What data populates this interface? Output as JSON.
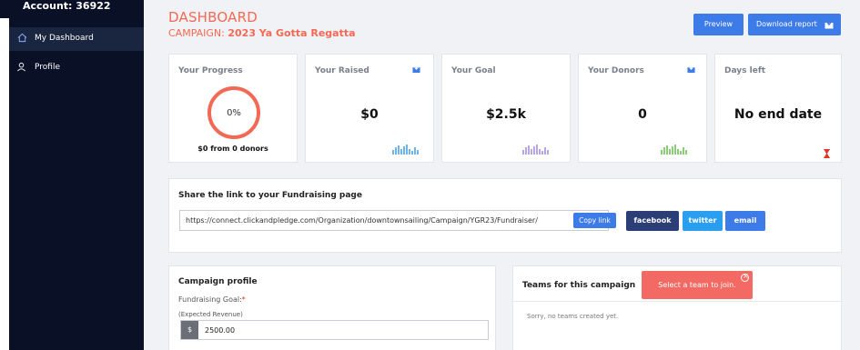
{
  "sidebar": {
    "account_label": "Account: 36922",
    "items": [
      {
        "label": "My Dashboard",
        "icon": "home-icon",
        "active": true
      },
      {
        "label": "Profile",
        "icon": "user-icon",
        "active": false
      }
    ]
  },
  "header": {
    "title": "DASHBOARD",
    "campaign_prefix": "CAMPAIGN:",
    "campaign_name": "2023 Ya Gotta Regatta",
    "preview_label": "Preview",
    "download_label": "Download report"
  },
  "stats": {
    "progress": {
      "title": "Your Progress",
      "percent": "0%",
      "sub": "$0 from 0 donors"
    },
    "raised": {
      "title": "Your Raised",
      "value": "$0"
    },
    "goal": {
      "title": "Your Goal",
      "value": "$2.5k"
    },
    "donors": {
      "title": "Your Donors",
      "value": "0"
    },
    "days": {
      "title": "Days left",
      "value": "No end date"
    }
  },
  "share": {
    "title": "Share the link to your Fundraising page",
    "url": "https://connect.clickandpledge.com/Organization/downtownsailing/Campaign/YGR23/Fundraiser/",
    "copy_label": "Copy link",
    "facebook_label": "facebook",
    "twitter_label": "twitter",
    "email_label": "email"
  },
  "profile": {
    "title": "Campaign profile",
    "goal_label": "Fundraising Goal:",
    "required_mark": "*",
    "expected_label": "(Expected Revenue)",
    "currency": "$",
    "amount": "2500.00"
  },
  "teams": {
    "title": "Teams for this campaign",
    "empty_text": "Sorry, no teams created yet.",
    "toast": "Select a team to join."
  },
  "colors": {
    "accent": "#f26a55",
    "sidebar_bg": "#0a1127",
    "button_blue": "#3d7be8",
    "facebook": "#2b3e76",
    "twitter": "#2a9ef1"
  }
}
